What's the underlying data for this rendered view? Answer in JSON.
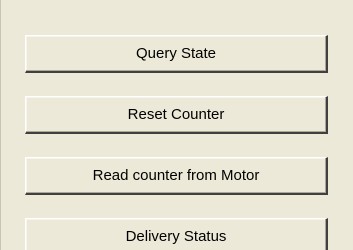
{
  "buttons": {
    "query_state": "Query State",
    "reset_counter": "Reset Counter",
    "read_counter": "Read counter from Motor",
    "delivery_status": "Delivery Status"
  }
}
